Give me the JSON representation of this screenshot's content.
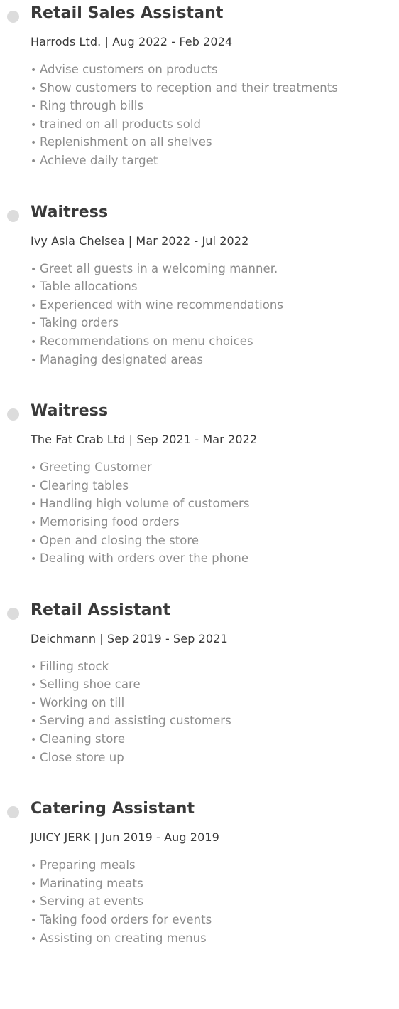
{
  "jobs": [
    {
      "title": "Retail Sales Assistant",
      "company": "Harrods Ltd.",
      "period": "Aug 2022 - Feb 2024",
      "duties": [
        "Advise customers on products",
        "Show customers to reception and their treatments",
        "Ring through bills",
        "trained on all products sold",
        "Replenishment on all shelves",
        "Achieve daily target"
      ]
    },
    {
      "title": "Waitress",
      "company": "Ivy Asia Chelsea",
      "period": "Mar 2022 - Jul 2022",
      "duties": [
        "Greet all guests in a welcoming manner.",
        "Table allocations",
        "Experienced with wine recommendations",
        "Taking orders",
        "Recommendations on menu choices",
        "Managing designated areas"
      ]
    },
    {
      "title": "Waitress",
      "company": "The Fat Crab Ltd",
      "period": "Sep 2021 - Mar 2022",
      "duties": [
        "Greeting Customer",
        "Clearing tables",
        "Handling high volume of customers",
        "Memorising food orders",
        "Open and closing the store",
        "Dealing with orders over the phone"
      ]
    },
    {
      "title": "Retail Assistant",
      "company": "Deichmann",
      "period": "Sep 2019 - Sep 2021",
      "duties": [
        "Filling stock",
        "Selling shoe care",
        "Working on till",
        "Serving and assisting customers",
        "Cleaning store",
        "Close store up"
      ]
    },
    {
      "title": "Catering Assistant",
      "company": "JUICY JERK",
      "period": "Jun 2019 - Aug 2019",
      "duties": [
        "Preparing meals",
        "Marinating meats",
        "Serving at events",
        "Taking food orders for events",
        "Assisting on creating menus"
      ]
    }
  ],
  "separator": " | ",
  "bullet_char": "•",
  "colors": {
    "dot": "#dcdcdc",
    "heading": "#3a3a3a",
    "duty_text": "#8c8c8c",
    "background": "#ffffff"
  }
}
